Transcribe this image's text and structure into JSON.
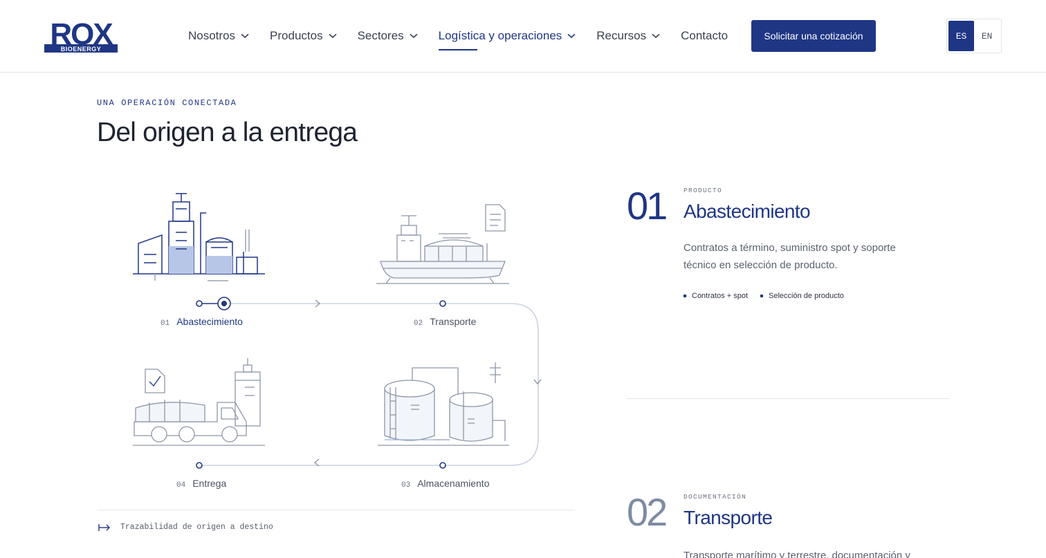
{
  "brand": {
    "logo_text": "ROX",
    "logo_subtext": "BIOENERGY",
    "color": "#1f3685"
  },
  "nav": {
    "items": [
      {
        "label": "Nosotros",
        "dropdown": true
      },
      {
        "label": "Productos",
        "dropdown": true
      },
      {
        "label": "Sectores",
        "dropdown": true
      },
      {
        "label": "Logística y operaciones",
        "dropdown": true,
        "active": true
      },
      {
        "label": "Recursos",
        "dropdown": true
      },
      {
        "label": "Contacto",
        "dropdown": false
      }
    ],
    "cta_label": "Solicitar una cotización",
    "lang": {
      "es": "ES",
      "en": "EN",
      "selected": "ES"
    }
  },
  "section": {
    "eyebrow": "UNA OPERACIÓN CONECTADA",
    "title": "Del origen a la entrega"
  },
  "diagram": {
    "steps": [
      {
        "num": "01",
        "label": "Abastecimiento",
        "icon": "refinery-icon",
        "active": true
      },
      {
        "num": "02",
        "label": "Transporte",
        "icon": "ship-icon"
      },
      {
        "num": "03",
        "label": "Almacenamiento",
        "icon": "storage-tanks-icon"
      },
      {
        "num": "04",
        "label": "Entrega",
        "icon": "tanker-truck-icon"
      }
    ],
    "footer": "Trazabilidad de origen a destino"
  },
  "features": [
    {
      "num": "01",
      "tag": "PRODUCTO",
      "title": "Abastecimiento",
      "desc": "Contratos a término, suministro spot y soporte técnico en selección de producto.",
      "chips": [
        "Contratos + spot",
        "Selección de producto"
      ]
    },
    {
      "num": "02",
      "tag": "DOCUMENTACIÓN",
      "title": "Transporte",
      "desc": "Transporte marítimo y terrestre, documentación y"
    }
  ]
}
